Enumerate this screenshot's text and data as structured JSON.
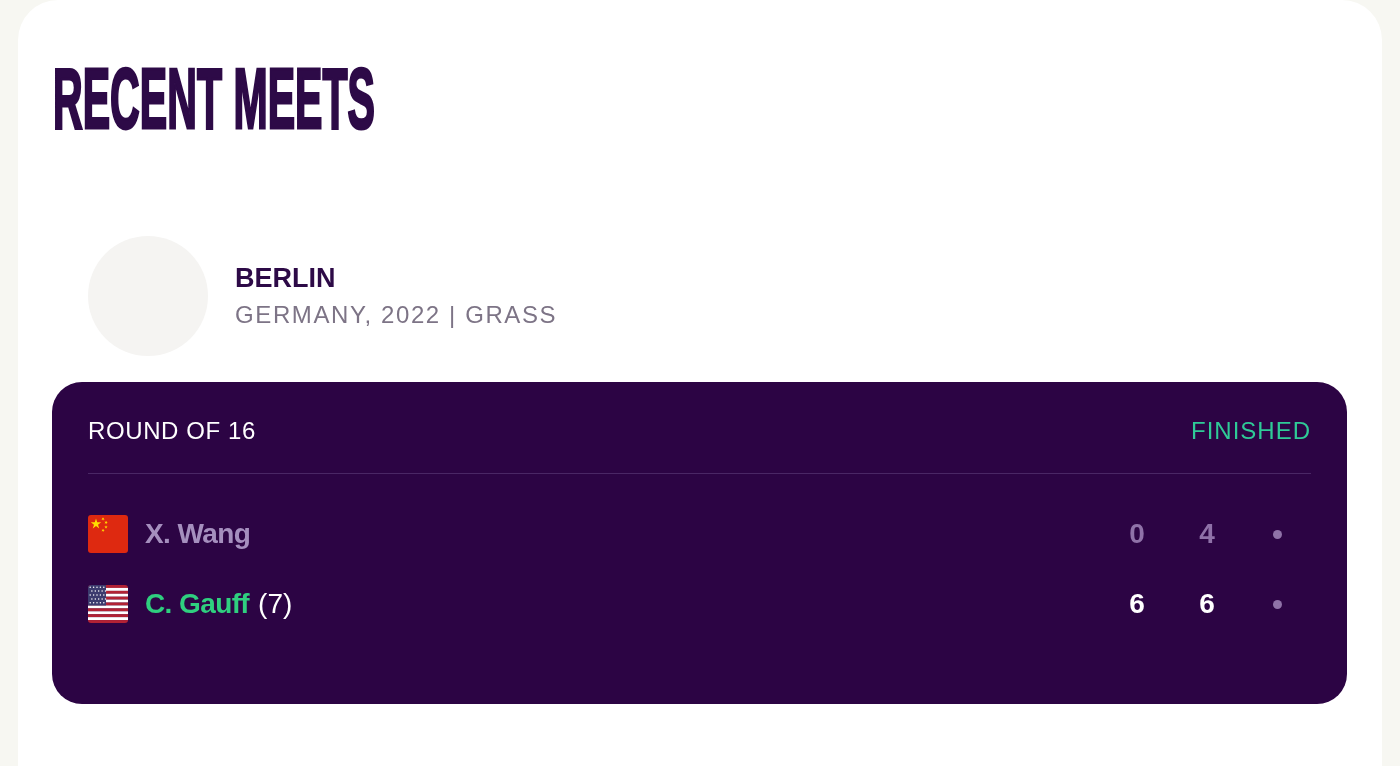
{
  "section": {
    "title": "RECENT MEETS"
  },
  "tournament": {
    "name": "BERLIN",
    "details": "GERMANY, 2022 | GRASS"
  },
  "match": {
    "round": "ROUND OF 16",
    "status": "FINISHED",
    "players": [
      {
        "kind": "china",
        "name": "X. Wang",
        "winner": false,
        "sets": [
          {
            "kind": "score",
            "value": "0"
          },
          {
            "kind": "score",
            "value": "4"
          },
          {
            "kind": "unplayed"
          }
        ]
      },
      {
        "kind": "usa",
        "name": "C. Gauff",
        "seed": "(7)",
        "winner": true,
        "sets": [
          {
            "kind": "score",
            "value": "6"
          },
          {
            "kind": "score",
            "value": "6"
          },
          {
            "kind": "unplayed"
          }
        ]
      }
    ]
  }
}
